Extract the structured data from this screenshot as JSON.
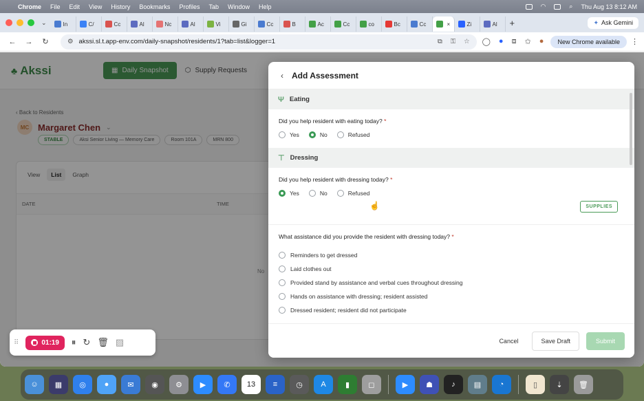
{
  "menubar": {
    "items": [
      "Chrome",
      "File",
      "Edit",
      "View",
      "History",
      "Bookmarks",
      "Profiles",
      "Tab",
      "Window",
      "Help"
    ],
    "datetime": "Thu Aug 13  8:12 AM"
  },
  "browser": {
    "tabs": [
      {
        "label": "In",
        "color": "#4a7bd0"
      },
      {
        "label": "C/",
        "color": "#3b82f6"
      },
      {
        "label": "Cc",
        "color": "#d9534f"
      },
      {
        "label": "Al",
        "color": "#5c6bc0"
      },
      {
        "label": "Nc",
        "color": "#e57373"
      },
      {
        "label": "Al",
        "color": "#5c6bc0"
      },
      {
        "label": "Vi",
        "color": "#7cb342"
      },
      {
        "label": "Gi",
        "color": "#666666"
      },
      {
        "label": "Cc",
        "color": "#4a7bd0"
      },
      {
        "label": "B",
        "color": "#d9534f"
      },
      {
        "label": "Ac",
        "color": "#43a047"
      },
      {
        "label": "Cc",
        "color": "#43a047"
      },
      {
        "label": "co",
        "color": "#43a047"
      },
      {
        "label": "Bc",
        "color": "#e53935"
      },
      {
        "label": "Cc",
        "color": "#4a7bd0"
      },
      {
        "label": "",
        "color": "#43a047"
      },
      {
        "label": "Zi",
        "color": "#2962ff"
      },
      {
        "label": "Al",
        "color": "#5c6bc0"
      }
    ],
    "ask_gemini": "Ask Gemini",
    "url": "akssi.sl.t.app-env.com/daily-snapshot/residents/1?tab=list&logger=1",
    "new_chrome": "New Chrome available"
  },
  "app": {
    "logo": "Akssi",
    "nav": {
      "daily_snapshot": "Daily Snapshot",
      "supply_requests": "Supply Requests"
    },
    "back_link": "Back to Residents",
    "resident": {
      "initials": "MC",
      "name": "Margaret Chen",
      "status": "STABLE",
      "facility": "Aksi Senior Living — Memory Care",
      "room": "Room 101A",
      "mrn": "MRN 800(",
      "mrn_visible": "MRN 800"
    },
    "view_tabs": {
      "label": "View",
      "list": "List",
      "graph": "Graph"
    },
    "table": {
      "date": "DATE",
      "time": "TIME"
    },
    "no_data": "No"
  },
  "modal": {
    "title": "Add Assessment",
    "eating": {
      "section": "Eating",
      "question": "Did you help resident with eating today?",
      "options": [
        "Yes",
        "No",
        "Refused"
      ],
      "selected": "No"
    },
    "dressing": {
      "section": "Dressing",
      "question": "Did you help resident with dressing today?",
      "options": [
        "Yes",
        "No",
        "Refused"
      ],
      "selected": "Yes",
      "supplies": "SUPPLIES",
      "assist_question": "What assistance did you provide the resident with dressing today?",
      "assist_options": [
        "Reminders to get dressed",
        "Laid clothes out",
        "Provided stand by assistance and verbal cues throughout dressing",
        "Hands on assistance with dressing; resident assisted",
        "Dressed resident; resident did not participate"
      ]
    },
    "required_mark": "*",
    "footer": {
      "cancel": "Cancel",
      "save_draft": "Save Draft",
      "submit": "Submit"
    }
  },
  "recorder": {
    "time": "01:19"
  },
  "dock": {
    "calendar_day": "13"
  }
}
